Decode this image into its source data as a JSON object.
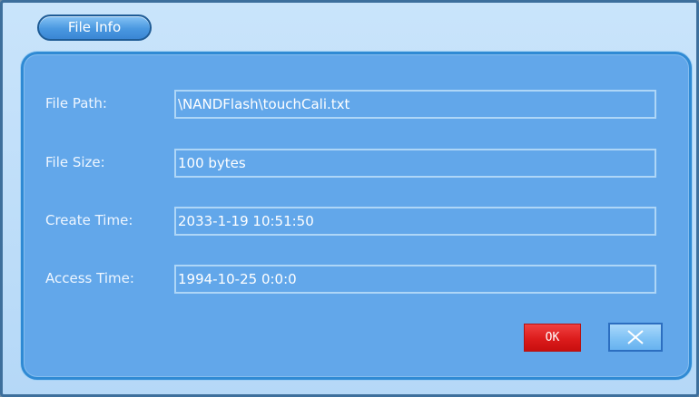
{
  "dialog": {
    "title": "File Info",
    "fields": [
      {
        "label": "File Path:",
        "value": "\\NANDFlash\\touchCali.txt"
      },
      {
        "label": "File Size:",
        "value": "100 bytes"
      },
      {
        "label": "Create Time:",
        "value": "2033-1-19 10:51:50"
      },
      {
        "label": "Access Time:",
        "value": "1994-10-25 0:0:0"
      }
    ],
    "ok_label": "OK",
    "close_icon": "close-icon"
  },
  "colors": {
    "panel": "#62a7ea",
    "ok_button": "#dc1c1c",
    "title_tab": "#4a98e0"
  }
}
